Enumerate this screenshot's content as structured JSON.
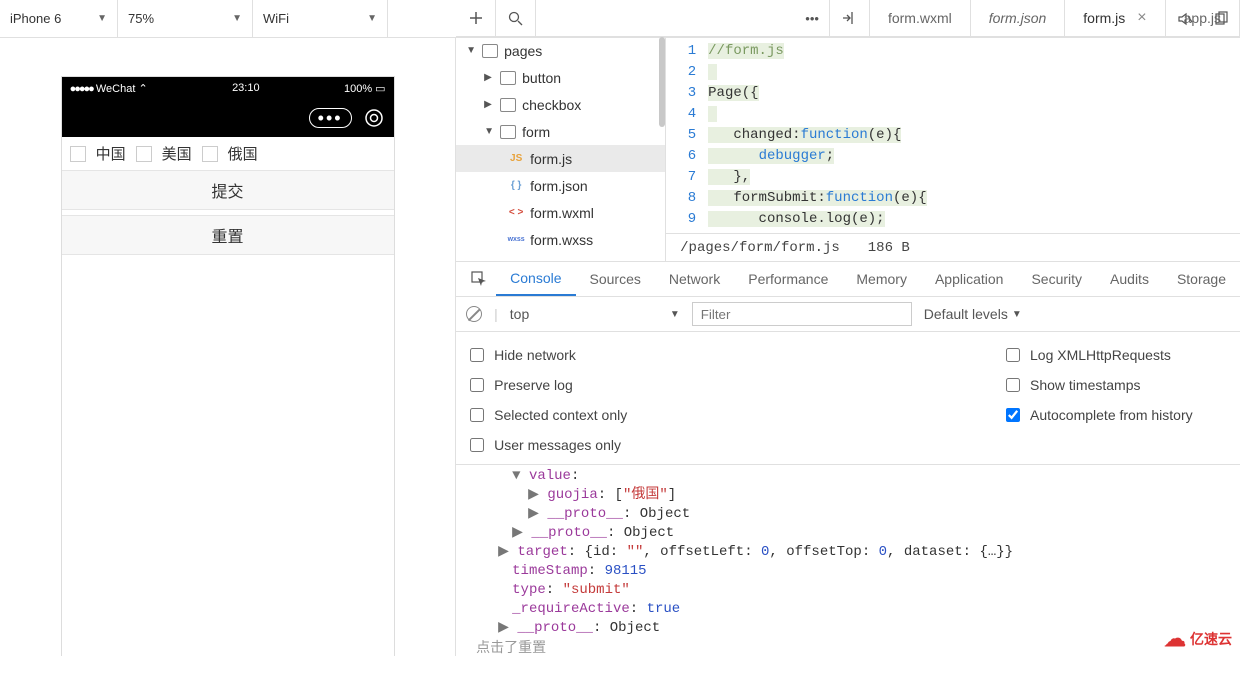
{
  "topbar": {
    "device": "iPhone 6",
    "zoom": "75%",
    "network": "WiFi"
  },
  "editorTabs": [
    {
      "label": "form.wxml",
      "active": false,
      "italic": false,
      "closable": false
    },
    {
      "label": "form.json",
      "active": false,
      "italic": true,
      "closable": false
    },
    {
      "label": "form.js",
      "active": true,
      "italic": false,
      "closable": true
    },
    {
      "label": "app.js",
      "active": false,
      "italic": false,
      "closable": false
    }
  ],
  "phone": {
    "carrier": "WeChat",
    "time": "23:10",
    "battery": "100%",
    "options": [
      "中国",
      "美国",
      "俄国"
    ],
    "submit": "提交",
    "reset": "重置"
  },
  "tree": {
    "root": "pages",
    "folders": [
      {
        "name": "button",
        "open": false
      },
      {
        "name": "checkbox",
        "open": false
      },
      {
        "name": "form",
        "open": true,
        "files": [
          {
            "name": "form.js",
            "type": "js",
            "selected": true
          },
          {
            "name": "form.json",
            "type": "json"
          },
          {
            "name": "form.wxml",
            "type": "wxml"
          },
          {
            "name": "form.wxss",
            "type": "wxss"
          }
        ]
      }
    ]
  },
  "code": {
    "lines": [
      "//form.js",
      "",
      "Page({",
      "",
      "   changed:function(e){",
      "      debugger;",
      "   },",
      "   formSubmit:function(e){",
      "      console.log(e);"
    ]
  },
  "status": {
    "path": "/pages/form/form.js",
    "size": "186 B"
  },
  "devtools": {
    "tabs": [
      "Console",
      "Sources",
      "Network",
      "Performance",
      "Memory",
      "Application",
      "Security",
      "Audits",
      "Storage"
    ],
    "active": "Console",
    "context": "top",
    "filterPlaceholder": "Filter",
    "levels": "Default levels",
    "checksLeft": [
      "Hide network",
      "Preserve log",
      "Selected context only",
      "User messages only"
    ],
    "checksRight": [
      {
        "label": "Log XMLHttpRequests",
        "checked": false
      },
      {
        "label": "Show timestamps",
        "checked": false
      },
      {
        "label": "Autocomplete from history",
        "checked": true
      }
    ]
  },
  "console": {
    "lines": [
      {
        "indent": 56,
        "pre": "▼ ",
        "key": "value",
        "sep": ":",
        "rest": ""
      },
      {
        "indent": 72,
        "pre": "▶ ",
        "key": "guojia",
        "sep": ": ",
        "rest_raw": "[\"俄国\"]"
      },
      {
        "indent": 72,
        "pre": "▶ ",
        "key": "__proto__",
        "sep": ": ",
        "rest": "Object"
      },
      {
        "indent": 56,
        "pre": "▶ ",
        "key": "__proto__",
        "sep": ": ",
        "rest": "Object"
      },
      {
        "indent": 42,
        "pre": "▶ ",
        "key": "target",
        "sep": ": ",
        "rest": "{id: \"\", offsetLeft: 0, offsetTop: 0, dataset: {…}}"
      },
      {
        "indent": 56,
        "pre": "",
        "key": "timeStamp",
        "sep": ": ",
        "rest_blue": "98115"
      },
      {
        "indent": 56,
        "pre": "",
        "key": "type",
        "sep": ": ",
        "rest_red": "\"submit\""
      },
      {
        "indent": 56,
        "pre": "",
        "key": "_requireActive",
        "sep": ": ",
        "rest_blue": "true"
      },
      {
        "indent": 42,
        "pre": "▶ ",
        "key": "__proto__",
        "sep": ": ",
        "rest": "Object"
      }
    ],
    "footer": "点击了重置"
  },
  "branding": "亿速云"
}
